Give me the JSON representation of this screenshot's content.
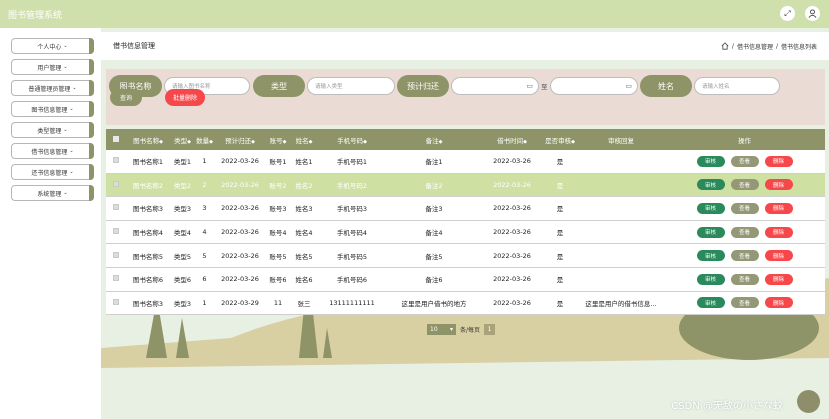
{
  "app": {
    "title": "图书管理系统"
  },
  "top_icons": [
    "fullscreen-icon",
    "user-icon"
  ],
  "sidebar": {
    "items": [
      {
        "label": "个人中心"
      },
      {
        "label": "用户管理"
      },
      {
        "label": "普通管理员管理"
      },
      {
        "label": "图书信息管理"
      },
      {
        "label": "类型管理"
      },
      {
        "label": "借书信息管理"
      },
      {
        "label": "还书信息管理"
      },
      {
        "label": "系统管理"
      }
    ]
  },
  "header": {
    "title": "借书信息管理",
    "breadcrumb": [
      "借书信息管理",
      "借书信息列表"
    ]
  },
  "search": {
    "book_name_label": "图书名称",
    "book_name_placeholder": "请输入图书名称",
    "type_label": "类型",
    "type_placeholder": "请输入类型",
    "return_date_label": "预计归还",
    "to_label": "至",
    "name_label": "姓名",
    "name_placeholder": "请输入姓名",
    "query_button": "查询",
    "batch_delete_button": "批量删除"
  },
  "table": {
    "headers": [
      "图书名称",
      "类型",
      "数量",
      "预计归还",
      "账号",
      "姓名",
      "手机号码",
      "备注",
      "借书时间",
      "是否审核",
      "审核回复",
      "操作"
    ],
    "rows": [
      {
        "book": "图书名称1",
        "type": "类型1",
        "qty": "1",
        "return": "2022-03-26",
        "account": "账号1",
        "name": "姓名1",
        "phone": "手机号码1",
        "remark": "备注1",
        "borrow": "2022-03-26",
        "approved": "是",
        "reply": ""
      },
      {
        "book": "图书名称2",
        "type": "类型2",
        "qty": "2",
        "return": "2022-03-26",
        "account": "账号2",
        "name": "姓名2",
        "phone": "手机号码2",
        "remark": "备注2",
        "borrow": "2022-03-26",
        "approved": "是",
        "reply": ""
      },
      {
        "book": "图书名称3",
        "type": "类型3",
        "qty": "3",
        "return": "2022-03-26",
        "account": "账号3",
        "name": "姓名3",
        "phone": "手机号码3",
        "remark": "备注3",
        "borrow": "2022-03-26",
        "approved": "是",
        "reply": ""
      },
      {
        "book": "图书名称4",
        "type": "类型4",
        "qty": "4",
        "return": "2022-03-26",
        "account": "账号4",
        "name": "姓名4",
        "phone": "手机号码4",
        "remark": "备注4",
        "borrow": "2022-03-26",
        "approved": "是",
        "reply": ""
      },
      {
        "book": "图书名称5",
        "type": "类型5",
        "qty": "5",
        "return": "2022-03-26",
        "account": "账号5",
        "name": "姓名5",
        "phone": "手机号码5",
        "remark": "备注5",
        "borrow": "2022-03-26",
        "approved": "是",
        "reply": ""
      },
      {
        "book": "图书名称6",
        "type": "类型6",
        "qty": "6",
        "return": "2022-03-26",
        "account": "账号6",
        "name": "姓名6",
        "phone": "手机号码6",
        "remark": "备注6",
        "borrow": "2022-03-26",
        "approved": "是",
        "reply": ""
      },
      {
        "book": "图书名称3",
        "type": "类型3",
        "qty": "1",
        "return": "2022-03-29",
        "account": "11",
        "name": "张三",
        "phone": "13111111111",
        "remark": "这里是用户借书的地方",
        "borrow": "2022-03-26",
        "approved": "是",
        "reply": "这里是用户的借书信息..."
      }
    ],
    "highlighted_row": 1,
    "actions": {
      "approve": "审核",
      "view": "查看",
      "delete": "删除"
    }
  },
  "pagination": {
    "page_size": "10",
    "per_page_label": "条/每页",
    "current_page": "1"
  },
  "watermark": "CSDN @无敌の小さな蚊",
  "colors": {
    "header_bar": "#cfe0ad",
    "accent": "#8e9467",
    "danger": "#f6484b",
    "approve": "#2a8a5c",
    "highlight_row": "#cfe0a3"
  }
}
